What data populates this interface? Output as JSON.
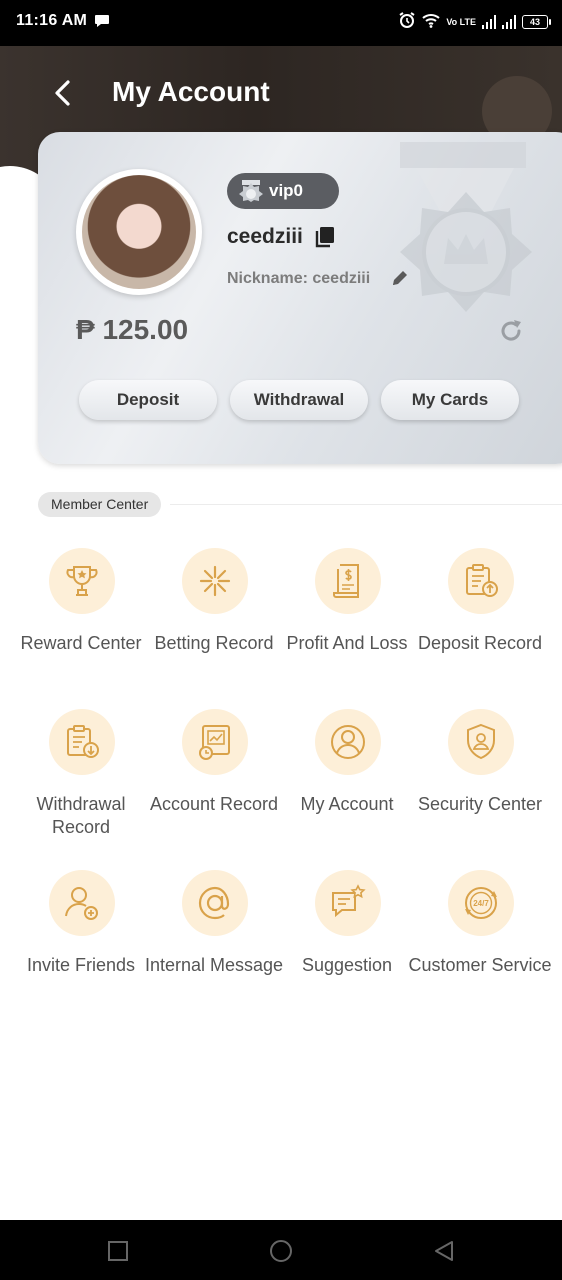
{
  "status_bar": {
    "time": "11:16 AM",
    "network": "Vo LTE",
    "battery": "43",
    "icons": [
      "message-icon",
      "alarm-icon",
      "wifi-icon",
      "signal-icon",
      "battery-icon"
    ]
  },
  "header": {
    "title": "My Account",
    "back_icon": "chevron-left-icon"
  },
  "profile": {
    "vip_level": "vip0",
    "username": "ceedziii",
    "nickname_label": "Nickname: ceedziii",
    "balance": "₱ 125.00",
    "buttons": {
      "deposit": "Deposit",
      "withdrawal": "Withdrawal",
      "my_cards": "My Cards"
    }
  },
  "member_center": {
    "title": "Member Center",
    "items": [
      {
        "label": "Reward Center",
        "icon": "trophy-icon"
      },
      {
        "label": "Betting Record",
        "icon": "betting-icon"
      },
      {
        "label": "Profit And Loss",
        "icon": "receipt-icon"
      },
      {
        "label": "Deposit Record",
        "icon": "deposit-record-icon"
      },
      {
        "label": "Withdrawal Record",
        "icon": "withdrawal-record-icon"
      },
      {
        "label": "Account Record",
        "icon": "account-record-icon"
      },
      {
        "label": "My Account",
        "icon": "user-icon"
      },
      {
        "label": "Security Center",
        "icon": "shield-user-icon"
      },
      {
        "label": "Invite Friends",
        "icon": "add-user-icon"
      },
      {
        "label": "Internal Message",
        "icon": "at-icon"
      },
      {
        "label": "Suggestion",
        "icon": "chat-star-icon"
      },
      {
        "label": "Customer Service",
        "icon": "24-7-icon"
      }
    ]
  },
  "nav_bar": {
    "icons": [
      "recent-apps-icon",
      "home-icon",
      "back-icon"
    ]
  },
  "colors": {
    "accent_gold": "#d9a24a",
    "icon_bg": "#fdefd8",
    "header_dark": "#2d2622"
  }
}
